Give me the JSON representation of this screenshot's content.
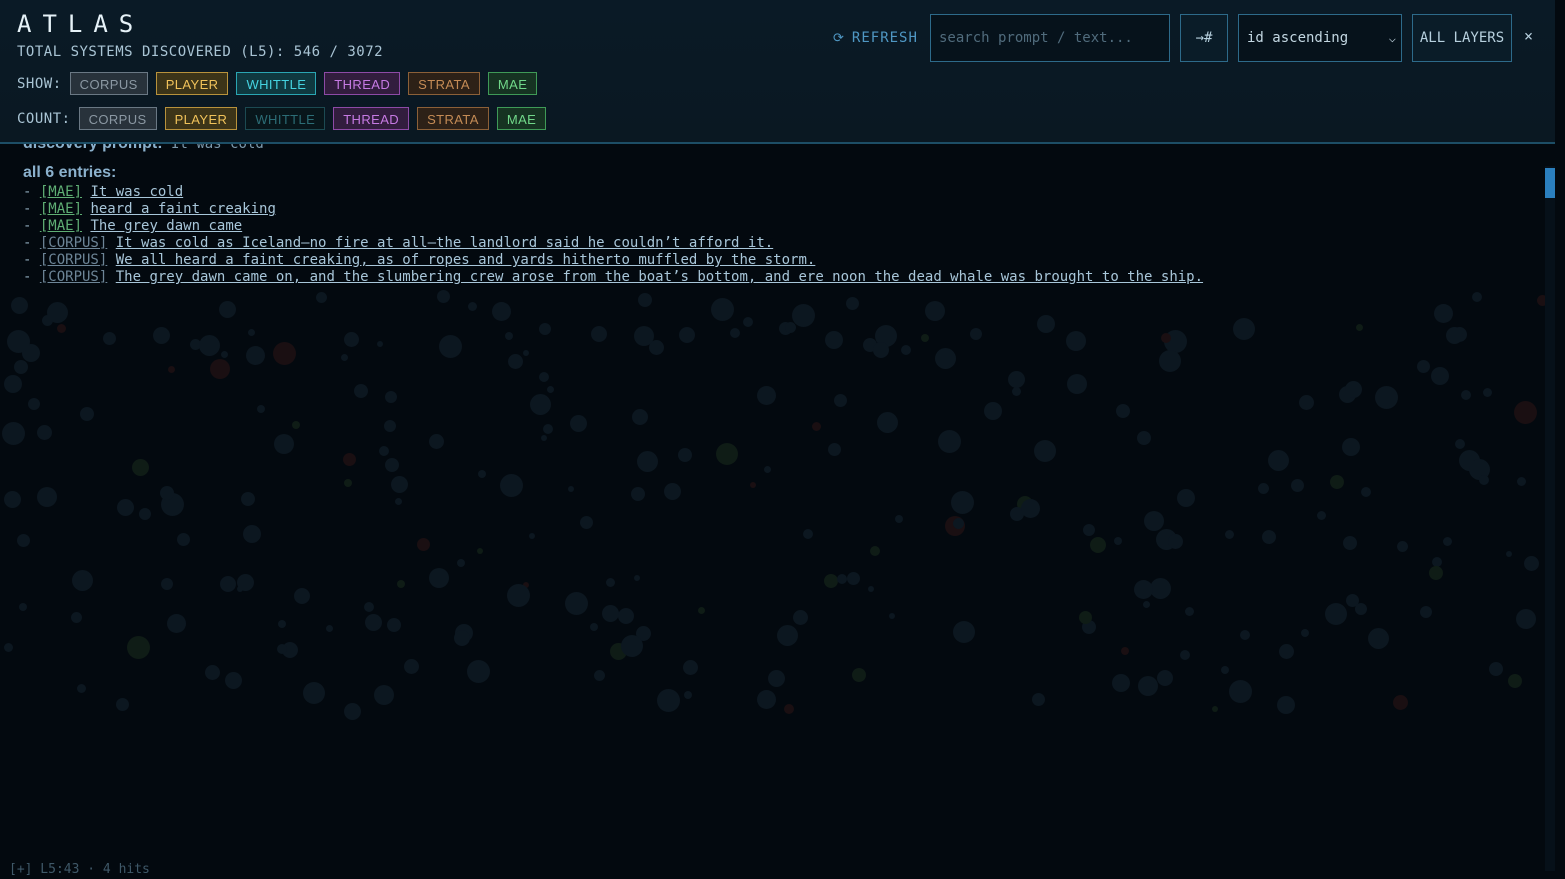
{
  "app": {
    "title": "ATLAS",
    "systems_count": "TOTAL SYSTEMS DISCOVERED (L5): 546 / 3072"
  },
  "filters": {
    "show_label": "SHOW:",
    "count_label": "COUNT:",
    "show": [
      {
        "label": "CORPUS",
        "key": "corpus"
      },
      {
        "label": "PLAYER",
        "key": "player"
      },
      {
        "label": "WHITTLE",
        "key": "whittle"
      },
      {
        "label": "THREAD",
        "key": "thread"
      },
      {
        "label": "STRATA",
        "key": "strata"
      },
      {
        "label": "MAE",
        "key": "mae"
      }
    ],
    "count": [
      {
        "label": "CORPUS",
        "key": "corpus"
      },
      {
        "label": "PLAYER",
        "key": "player"
      },
      {
        "label": "WHITTLE",
        "key": "whittle-off"
      },
      {
        "label": "THREAD",
        "key": "thread"
      },
      {
        "label": "STRATA",
        "key": "strata"
      },
      {
        "label": "MAE",
        "key": "mae"
      }
    ]
  },
  "toolbar": {
    "refresh_icon": "⟳",
    "refresh_label": "REFRESH",
    "search_placeholder": "search prompt / text...",
    "search_value": "",
    "jump_label": "→#",
    "sort_value": "id ascending",
    "layers_label": "ALL LAYERS",
    "close_label": "×"
  },
  "detail": {
    "prompt_label": "discovery prompt:",
    "prompt_value": "It was cold",
    "entries_heading": "all 6 entries:",
    "entries": [
      {
        "tag": "[MAE]",
        "layer": "mae",
        "text": "It was cold"
      },
      {
        "tag": "[MAE]",
        "layer": "mae",
        "text": "heard a faint creaking"
      },
      {
        "tag": "[MAE]",
        "layer": "mae",
        "text": "The grey dawn came"
      },
      {
        "tag": "[CORPUS]",
        "layer": "corpus",
        "text": "It was cold as Iceland—no fire at all—the landlord said he couldn’t afford it."
      },
      {
        "tag": "[CORPUS]",
        "layer": "corpus",
        "text": "We all heard a faint creaking, as of ropes and yards hitherto muffled by the storm."
      },
      {
        "tag": "[CORPUS]",
        "layer": "corpus",
        "text": "The grey dawn came on, and the slumbering crew arose from the boat’s bottom, and ere noon the dead whale was brought to the ship."
      }
    ]
  },
  "status": {
    "text": "[+] L5:43 · 4 hits"
  }
}
